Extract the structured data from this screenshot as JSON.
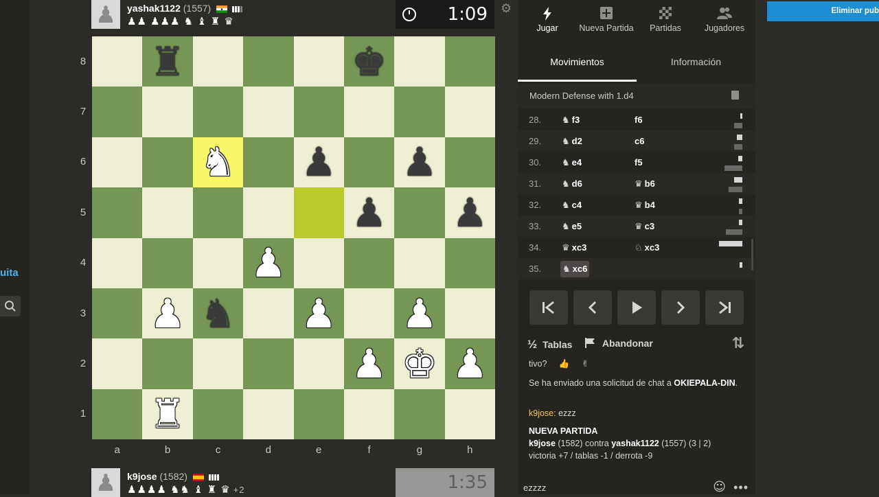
{
  "left": {
    "partial_text": "uita"
  },
  "top_player": {
    "name": "yashak1122",
    "rating": "(1557)",
    "captured": "♟♟ ♟♟♟ ♞ ♝ ♜ ♛",
    "clock": "1:09"
  },
  "bottom_player": {
    "name": "k9jose",
    "rating": "(1582)",
    "captured": "♟♟♟♟ ♞♞ ♝ ♜ ♛",
    "advantage": "+2",
    "clock": "1:35"
  },
  "board": {
    "ranks": [
      "8",
      "7",
      "6",
      "5",
      "4",
      "3",
      "2",
      "1"
    ],
    "files": [
      "a",
      "b",
      "c",
      "d",
      "e",
      "f",
      "g",
      "h"
    ],
    "highlights": [
      {
        "square": "c6",
        "kind": "last-move"
      },
      {
        "square": "e5",
        "kind": "last-move-from"
      }
    ],
    "pieces": [
      {
        "square": "b8",
        "piece": "rook",
        "color": "black"
      },
      {
        "square": "f8",
        "piece": "king",
        "color": "black"
      },
      {
        "square": "c6",
        "piece": "knight",
        "color": "white"
      },
      {
        "square": "e6",
        "piece": "pawn",
        "color": "black"
      },
      {
        "square": "g6",
        "piece": "pawn",
        "color": "black"
      },
      {
        "square": "f5",
        "piece": "pawn",
        "color": "black"
      },
      {
        "square": "h5",
        "piece": "pawn",
        "color": "black"
      },
      {
        "square": "d4",
        "piece": "pawn",
        "color": "white"
      },
      {
        "square": "b3",
        "piece": "pawn",
        "color": "white"
      },
      {
        "square": "c3",
        "piece": "knight",
        "color": "black"
      },
      {
        "square": "e3",
        "piece": "pawn",
        "color": "white"
      },
      {
        "square": "g3",
        "piece": "pawn",
        "color": "white"
      },
      {
        "square": "f2",
        "piece": "pawn",
        "color": "white"
      },
      {
        "square": "g2",
        "piece": "king",
        "color": "white"
      },
      {
        "square": "h2",
        "piece": "pawn",
        "color": "white"
      },
      {
        "square": "b1",
        "piece": "rook",
        "color": "white"
      }
    ]
  },
  "nav": {
    "tabs": [
      {
        "label": "Jugar",
        "icon": "lightning-icon",
        "active": true
      },
      {
        "label": "Nueva Partida",
        "icon": "plus-icon",
        "active": false
      },
      {
        "label": "Partidas",
        "icon": "board-icon",
        "active": false
      },
      {
        "label": "Jugadores",
        "icon": "users-icon",
        "active": false
      }
    ]
  },
  "subtabs": [
    {
      "label": "Movimientos",
      "active": true
    },
    {
      "label": "Información",
      "active": false
    }
  ],
  "opening": "Modern Defense with 1.d4",
  "moves": [
    {
      "num": "28.",
      "white": {
        "fig": "♞",
        "san": "f3"
      },
      "black": {
        "fig": "",
        "san": "f6"
      }
    },
    {
      "num": "29.",
      "white": {
        "fig": "♞",
        "san": "d2"
      },
      "black": {
        "fig": "",
        "san": "c6"
      }
    },
    {
      "num": "30.",
      "white": {
        "fig": "♞",
        "san": "e4"
      },
      "black": {
        "fig": "",
        "san": "f5"
      }
    },
    {
      "num": "31.",
      "white": {
        "fig": "♞",
        "san": "d6"
      },
      "black": {
        "fig": "♛",
        "san": "b6"
      }
    },
    {
      "num": "32.",
      "white": {
        "fig": "♞",
        "san": "c4"
      },
      "black": {
        "fig": "♛",
        "san": "b4"
      }
    },
    {
      "num": "33.",
      "white": {
        "fig": "♞",
        "san": "e5"
      },
      "black": {
        "fig": "♛",
        "san": "c3"
      }
    },
    {
      "num": "34.",
      "white": {
        "fig": "♛",
        "san": "xc3"
      },
      "black": {
        "fig": "♘",
        "san": "xc3"
      }
    },
    {
      "num": "35.",
      "white": {
        "fig": "♞",
        "san": "xc6"
      },
      "black": {
        "fig": "",
        "san": ""
      }
    }
  ],
  "controls": {
    "first": "first-move-icon",
    "prev": "prev-move-icon",
    "play": "play-icon",
    "next": "next-move-icon",
    "last": "last-move-icon"
  },
  "actions": {
    "draw_symbol": "½",
    "draw": "Tablas",
    "resign": "Abandonar"
  },
  "chat": {
    "partial_line": "tivo?",
    "request_msg_prefix": "Se ha enviado una solicitud de chat a ",
    "request_user": "OKIEPALA-DIN",
    "request_suffix": ".",
    "msg_user": "k9jose:",
    "msg_text": " ezzz",
    "new_game_title": "NUEVA PARTIDA",
    "new_game_p1": "k9jose",
    "new_game_p1_rating": " (1582) contra ",
    "new_game_p2": "yashak1122",
    "new_game_rest": " (1557) (3 | 2)",
    "stats": "victoria +7 / tablas -1 / derrota -9",
    "input_value": "ezzzz"
  },
  "right": {
    "button_label": "Eliminar pub"
  }
}
